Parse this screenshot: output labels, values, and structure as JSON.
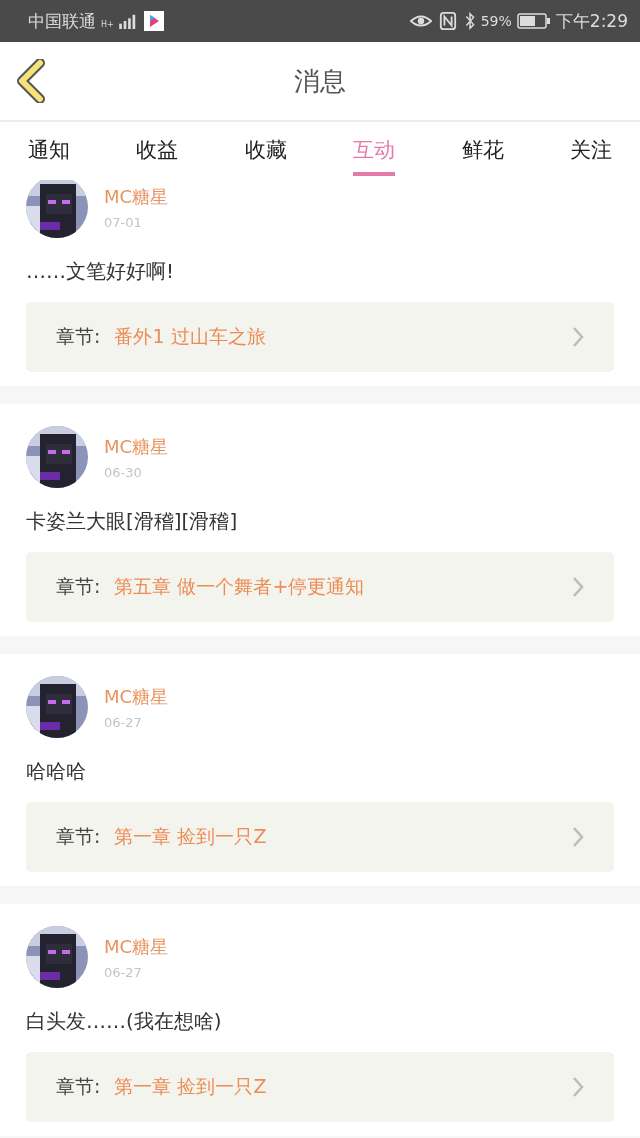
{
  "status_bar": {
    "carrier": "中国联通",
    "network": "H+",
    "battery_percent": "59%",
    "time": "下午2:29"
  },
  "header": {
    "title": "消息"
  },
  "tabs": [
    {
      "label": "通知",
      "selected": false
    },
    {
      "label": "收益",
      "selected": false
    },
    {
      "label": "收藏",
      "selected": false
    },
    {
      "label": "互动",
      "selected": true
    },
    {
      "label": "鲜花",
      "selected": false
    },
    {
      "label": "关注",
      "selected": false
    }
  ],
  "messages": [
    {
      "user": "MC糖星",
      "date": "07-01",
      "text": "……文笔好好啊!",
      "chapter_label": "章节:",
      "chapter": "番外1 过山车之旅"
    },
    {
      "user": "MC糖星",
      "date": "06-30",
      "text": "卡姿兰大眼[滑稽][滑稽]",
      "chapter_label": "章节:",
      "chapter": "第五章 做一个舞者+停更通知"
    },
    {
      "user": "MC糖星",
      "date": "06-27",
      "text": "哈哈哈",
      "chapter_label": "章节:",
      "chapter": "第一章 捡到一只Z"
    },
    {
      "user": "MC糖星",
      "date": "06-27",
      "text": "白头发……(我在想啥)",
      "chapter_label": "章节:",
      "chapter": "第一章 捡到一只Z"
    }
  ]
}
